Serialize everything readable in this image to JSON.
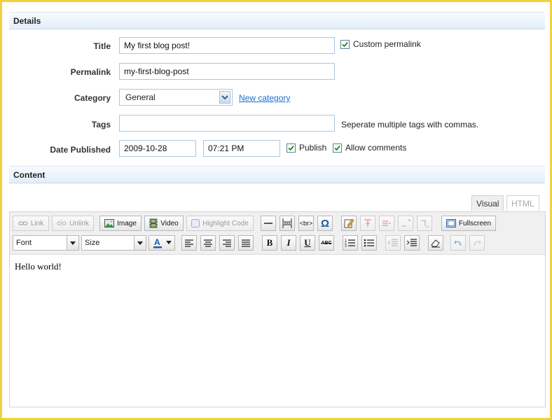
{
  "details": {
    "section_title": "Details",
    "title_label": "Title",
    "title_value": "My first blog post!",
    "custom_permalink_label": "Custom permalink",
    "permalink_label": "Permalink",
    "permalink_value": "my-first-blog-post",
    "category_label": "Category",
    "category_value": "General",
    "new_category_link": "New category",
    "tags_label": "Tags",
    "tags_value": "",
    "tags_hint": "Seperate multiple tags with commas.",
    "date_label": "Date Published",
    "date_value": "2009-10-28",
    "time_value": "07:21 PM",
    "publish_label": "Publish",
    "allow_comments_label": "Allow comments"
  },
  "content": {
    "section_title": "Content",
    "tabs": [
      {
        "label": "Visual"
      },
      {
        "label": "HTML"
      }
    ],
    "body_text": "Hello world!"
  },
  "toolbar": {
    "link": "Link",
    "unlink": "Unlink",
    "image": "Image",
    "video": "Video",
    "highlight_code": "Highlight Code",
    "br": "<br>",
    "omega": "Ω",
    "fullscreen": "Fullscreen",
    "font": "Font",
    "size": "Size",
    "bold": "B",
    "italic": "I",
    "underline": "U",
    "strike": "ABC"
  },
  "colors": {
    "accent_link": "#1a6fc9",
    "border_yellow": "#f1d23c",
    "input_border": "#a9c8e2"
  }
}
